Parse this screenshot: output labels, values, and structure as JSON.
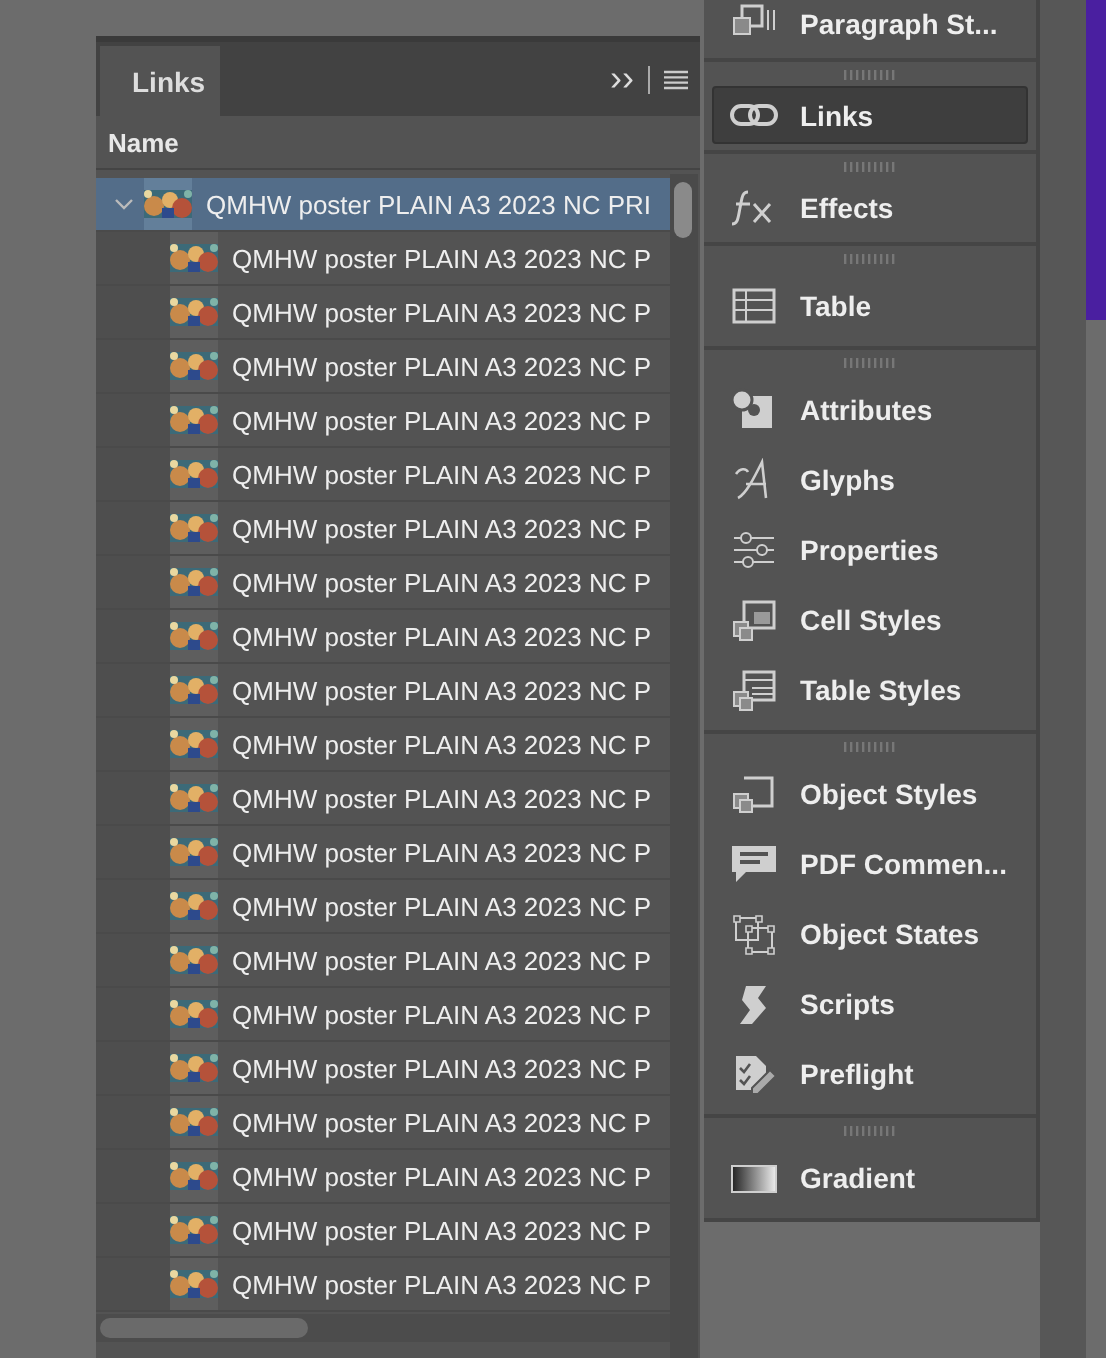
{
  "links_panel": {
    "tab": {
      "label": "Links",
      "selected": true
    },
    "panel_menu": {
      "collapse": "››"
    },
    "column": "Name",
    "rows": [
      {
        "name": "QMHW poster PLAIN A3 2023 NC PRI",
        "expanded": true,
        "selected": true,
        "children": [
          {
            "name": "QMHW poster PLAIN A3 2023 NC P",
            "selected": false
          },
          {
            "name": "QMHW poster PLAIN A3 2023 NC P",
            "selected": false
          },
          {
            "name": "QMHW poster PLAIN A3 2023 NC P",
            "selected": false
          },
          {
            "name": "QMHW poster PLAIN A3 2023 NC P",
            "selected": false
          },
          {
            "name": "QMHW poster PLAIN A3 2023 NC P",
            "selected": false
          },
          {
            "name": "QMHW poster PLAIN A3 2023 NC P",
            "selected": false
          },
          {
            "name": "QMHW poster PLAIN A3 2023 NC P",
            "selected": false
          },
          {
            "name": "QMHW poster PLAIN A3 2023 NC P",
            "selected": false
          },
          {
            "name": "QMHW poster PLAIN A3 2023 NC P",
            "selected": false
          },
          {
            "name": "QMHW poster PLAIN A3 2023 NC P",
            "selected": false
          },
          {
            "name": "QMHW poster PLAIN A3 2023 NC P",
            "selected": false
          },
          {
            "name": "QMHW poster PLAIN A3 2023 NC P",
            "selected": false
          },
          {
            "name": "QMHW poster PLAIN A3 2023 NC P",
            "selected": false
          },
          {
            "name": "QMHW poster PLAIN A3 2023 NC P",
            "selected": false
          },
          {
            "name": "QMHW poster PLAIN A3 2023 NC P",
            "selected": false
          },
          {
            "name": "QMHW poster PLAIN A3 2023 NC P",
            "selected": false
          },
          {
            "name": "QMHW poster PLAIN A3 2023 NC P",
            "selected": false
          },
          {
            "name": "QMHW poster PLAIN A3 2023 NC P",
            "selected": false
          },
          {
            "name": "QMHW poster PLAIN A3 2023 NC P",
            "selected": false
          },
          {
            "name": "QMHW poster PLAIN A3 2023 NC P",
            "selected": false
          }
        ]
      }
    ]
  },
  "dock": {
    "sections": [
      {
        "items": [
          {
            "label": "Paragraph St...",
            "kind": "paragraph-styles",
            "selected": false
          }
        ]
      },
      {
        "items": [
          {
            "label": "Links",
            "kind": "links",
            "selected": true
          }
        ]
      },
      {
        "items": [
          {
            "label": "Effects",
            "kind": "effects",
            "selected": false
          }
        ]
      },
      {
        "items": [
          {
            "label": "Table",
            "kind": "table",
            "selected": false
          }
        ]
      },
      {
        "items": [
          {
            "label": "Attributes",
            "kind": "attributes",
            "selected": false
          },
          {
            "label": "Glyphs",
            "kind": "glyphs",
            "selected": false
          },
          {
            "label": "Properties",
            "kind": "properties",
            "selected": false
          },
          {
            "label": "Cell Styles",
            "kind": "cell-styles",
            "selected": false
          },
          {
            "label": "Table Styles",
            "kind": "table-styles",
            "selected": false
          }
        ]
      },
      {
        "items": [
          {
            "label": "Object Styles",
            "kind": "object-styles",
            "selected": false
          },
          {
            "label": "PDF Commen...",
            "kind": "pdf-comments",
            "selected": false
          },
          {
            "label": "Object States",
            "kind": "object-states",
            "selected": false
          },
          {
            "label": "Scripts",
            "kind": "scripts",
            "selected": false
          },
          {
            "label": "Preflight",
            "kind": "preflight",
            "selected": false
          }
        ]
      },
      {
        "items": [
          {
            "label": "Gradient",
            "kind": "gradient",
            "selected": false
          }
        ]
      }
    ]
  }
}
